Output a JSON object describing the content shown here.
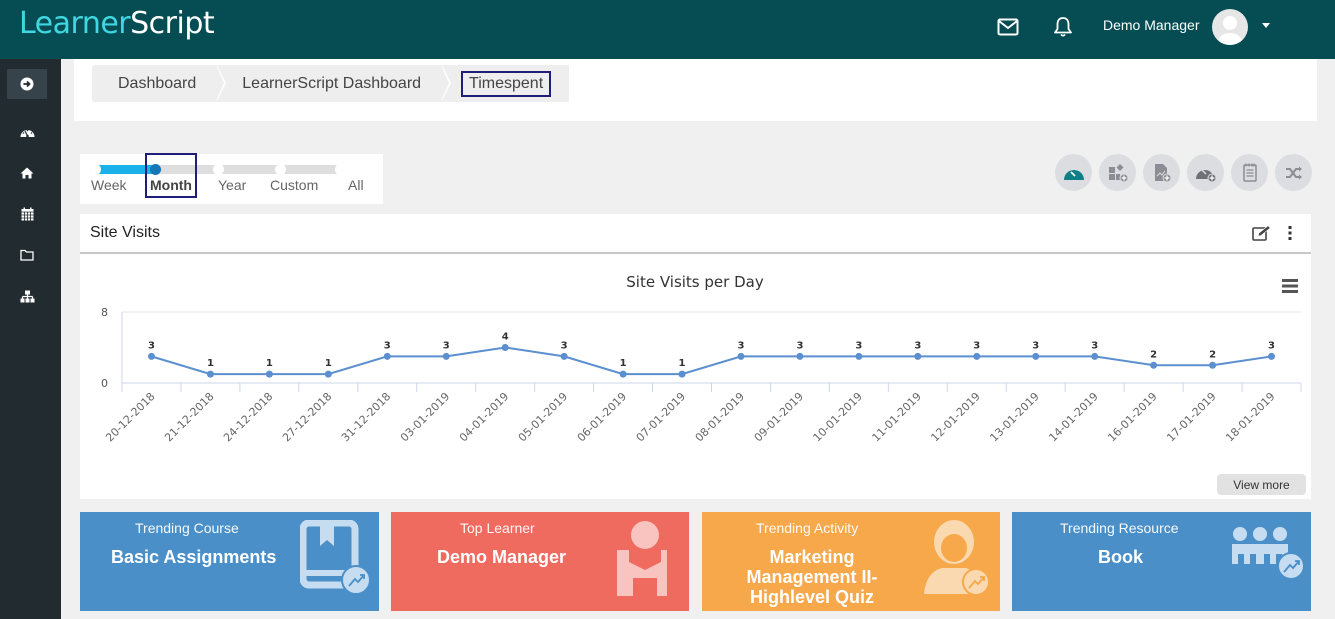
{
  "brand": {
    "part1": "Learner",
    "part2": "Script"
  },
  "header": {
    "user_name": "Demo Manager",
    "icons": [
      "mail-icon",
      "bell-icon",
      "avatar",
      "caret-down-icon"
    ]
  },
  "sidebar": {
    "items": [
      {
        "name": "expand",
        "icon": "arrow-circle-right-icon",
        "active": true
      },
      {
        "name": "dashboard",
        "icon": "dashboard-gauge-icon"
      },
      {
        "name": "home",
        "icon": "home-icon"
      },
      {
        "name": "calendar",
        "icon": "calendar-icon"
      },
      {
        "name": "folder",
        "icon": "folder-icon"
      },
      {
        "name": "sitemap",
        "icon": "sitemap-icon"
      }
    ]
  },
  "breadcrumb": {
    "items": [
      "Dashboard",
      "LearnerScript Dashboard",
      "Timespent"
    ]
  },
  "range": {
    "options": [
      "Week",
      "Month",
      "Year",
      "Custom",
      "All"
    ],
    "selected": "Month"
  },
  "actions": {
    "icons": [
      "dashboard-icon",
      "add-widget-icon",
      "add-report-icon",
      "add-dashboard-icon",
      "notes-icon",
      "shuffle-icon"
    ]
  },
  "card": {
    "title": "Site Visits",
    "view_more": "View more"
  },
  "chart_data": {
    "type": "line",
    "title": "Site Visits per Day",
    "xlabel": "",
    "ylabel": "",
    "ylim": [
      0,
      8
    ],
    "yticks": [
      0,
      8
    ],
    "grid": false,
    "legend": "none",
    "categories": [
      "20-12-2018",
      "21-12-2018",
      "24-12-2018",
      "27-12-2018",
      "31-12-2018",
      "03-01-2019",
      "04-01-2019",
      "05-01-2019",
      "06-01-2019",
      "07-01-2019",
      "08-01-2019",
      "09-01-2019",
      "10-01-2019",
      "11-01-2019",
      "12-01-2019",
      "13-01-2019",
      "14-01-2019",
      "16-01-2019",
      "17-01-2019",
      "18-01-2019"
    ],
    "series": [
      {
        "name": "Site Visits",
        "color": "#5b8fcf",
        "values": [
          3,
          1,
          1,
          1,
          3,
          3,
          4,
          3,
          1,
          1,
          3,
          3,
          3,
          3,
          3,
          3,
          3,
          2,
          2,
          3
        ]
      }
    ]
  },
  "tiles": [
    {
      "label": "Trending Course",
      "value": "Basic Assignments",
      "color": "#4a8fc8",
      "icon": "book-trend-icon"
    },
    {
      "label": "Top Learner",
      "value": "Demo Manager",
      "color": "#ef6a5f",
      "icon": "learner-icon"
    },
    {
      "label": "Trending Activity",
      "value": "Marketing Management II-Highlevel Quiz",
      "color": "#f6a84b",
      "icon": "user-trend-icon"
    },
    {
      "label": "Trending Resource",
      "value": "Book",
      "color": "#4a8fc8",
      "icon": "group-trend-icon"
    }
  ],
  "colors": {
    "topbar": "#054d52",
    "sidebar": "#222b30",
    "accent": "#1ab2e8"
  }
}
